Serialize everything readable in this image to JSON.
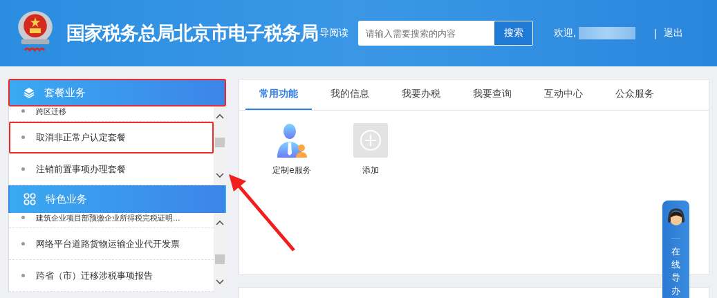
{
  "header": {
    "title": "国家税务总局北京市电子税务局",
    "guide_link": "导阅读",
    "search": {
      "placeholder": "请输入需要搜索的内容",
      "button": "搜索"
    },
    "welcome": "欢迎,",
    "separator": "|",
    "logout": "退出"
  },
  "sidebar": {
    "sections": [
      {
        "title": "套餐业务",
        "highlighted": true,
        "items": [
          {
            "label": "跨区迁移",
            "highlighted": false
          },
          {
            "label": "取消非正常户认定套餐",
            "highlighted": true
          },
          {
            "label": "注销前置事项办理套餐",
            "highlighted": false
          }
        ]
      },
      {
        "title": "特色业务",
        "highlighted": false,
        "items": [
          {
            "label": "建筑企业项目部预缴企业所得税完税证明...",
            "highlighted": false
          },
          {
            "label": "网络平台道路货物运输企业代开发票",
            "highlighted": false
          },
          {
            "label": "跨省（市）迁移涉税事项报告",
            "highlighted": false
          }
        ]
      }
    ]
  },
  "tabs": [
    {
      "label": "常用功能",
      "selected": true
    },
    {
      "label": "我的信息",
      "selected": false
    },
    {
      "label": "我要办税",
      "selected": false
    },
    {
      "label": "我要查询",
      "selected": false
    },
    {
      "label": "互动中心",
      "selected": false
    },
    {
      "label": "公众服务",
      "selected": false
    }
  ],
  "shortcuts": [
    {
      "label": "定制e服务",
      "kind": "person"
    },
    {
      "label": "添加",
      "kind": "add"
    }
  ],
  "assistant": {
    "label": "在线导办"
  }
}
